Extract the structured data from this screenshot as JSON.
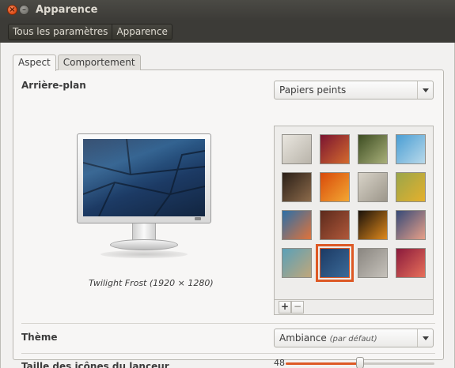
{
  "window": {
    "title": "Apparence",
    "close_icon": "close-icon",
    "minimize_icon": "minimize-icon"
  },
  "breadcrumb": [
    "Tous les paramètres",
    "Apparence"
  ],
  "tabs": [
    {
      "label": "Aspect",
      "active": true
    },
    {
      "label": "Comportement",
      "active": false
    }
  ],
  "background": {
    "label": "Arrière-plan",
    "source": "Papiers peints",
    "current": "Twilight Frost (1920 × 1280)",
    "add_label": "+",
    "remove_label": "−",
    "wallpapers": [
      {
        "c1": "#e9e6df",
        "c2": "#b9b4aa"
      },
      {
        "c1": "#7a1430",
        "c2": "#d46b2e"
      },
      {
        "c1": "#3d4d22",
        "c2": "#a9b07a"
      },
      {
        "c1": "#4a9ed4",
        "c2": "#b9d9ea"
      },
      {
        "c1": "#2a1f17",
        "c2": "#8c6a4a"
      },
      {
        "c1": "#d84a0a",
        "c2": "#f3a733"
      },
      {
        "c1": "#d8d3c8",
        "c2": "#9c968a"
      },
      {
        "c1": "#9aa64a",
        "c2": "#e5b02c"
      },
      {
        "c1": "#2b6fa8",
        "c2": "#e0733a"
      },
      {
        "c1": "#5c2a1c",
        "c2": "#b0583a"
      },
      {
        "c1": "#1a120b",
        "c2": "#e08a1c"
      },
      {
        "c1": "#364a78",
        "c2": "#e8a088"
      },
      {
        "c1": "#5aa0b8",
        "c2": "#c0a77a"
      },
      {
        "c1": "#1c3a64",
        "c2": "#3b6a98"
      },
      {
        "c1": "#8a8680",
        "c2": "#c6c2bb"
      },
      {
        "c1": "#8a1a3c",
        "c2": "#e8705a"
      }
    ],
    "selected_index": 13
  },
  "theme": {
    "label": "Thème",
    "value": "Ambiance",
    "value_note": "(par défaut)"
  },
  "launcher": {
    "label": "Taille des icônes du lanceur",
    "value": "48",
    "min": 32,
    "max": 64,
    "level": 48
  },
  "colors": {
    "accent": "#dd5925",
    "titlebar": "#3c3b37",
    "panel": "#f7f6f5"
  }
}
